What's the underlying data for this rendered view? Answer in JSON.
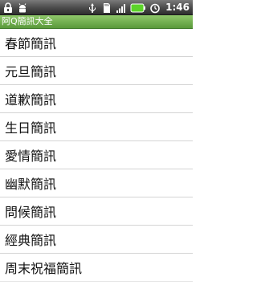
{
  "status_bar": {
    "time": "1:46",
    "icons": [
      "lock-icon",
      "android-debug-icon",
      "usb-icon",
      "sd-card-icon",
      "signal-icon",
      "battery-icon",
      "alarm-icon"
    ]
  },
  "app": {
    "title": "阿Q簡訊大全"
  },
  "list": {
    "items": [
      {
        "label": "春節簡訊"
      },
      {
        "label": "元旦簡訊"
      },
      {
        "label": "道歉簡訊"
      },
      {
        "label": "生日簡訊"
      },
      {
        "label": "愛情簡訊"
      },
      {
        "label": "幽默簡訊"
      },
      {
        "label": "問候簡訊"
      },
      {
        "label": "經典簡訊"
      },
      {
        "label": "周末祝福簡訊"
      }
    ]
  },
  "colors": {
    "title_bar": "#6fb04a",
    "status_bar": "#3a3a3a",
    "battery": "#5cd32a",
    "divider": "#d4d4d4"
  }
}
